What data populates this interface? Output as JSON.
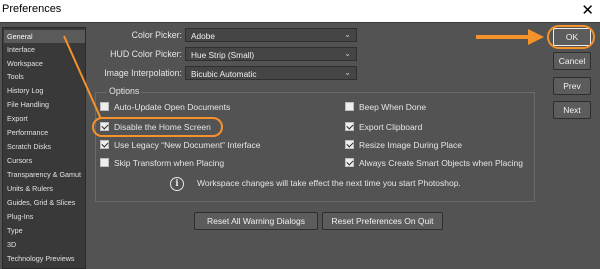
{
  "window": {
    "title": "Preferences",
    "close_glyph": "✕"
  },
  "sidebar": {
    "items": [
      {
        "label": "General",
        "selected": true
      },
      {
        "label": "Interface"
      },
      {
        "label": "Workspace"
      },
      {
        "label": "Tools"
      },
      {
        "label": "History Log"
      },
      {
        "label": "File Handling"
      },
      {
        "label": "Export"
      },
      {
        "label": "Performance"
      },
      {
        "label": "Scratch Disks"
      },
      {
        "label": "Cursors"
      },
      {
        "label": "Transparency & Gamut"
      },
      {
        "label": "Units & Rulers"
      },
      {
        "label": "Guides, Grid & Slices"
      },
      {
        "label": "Plug-Ins"
      },
      {
        "label": "Type"
      },
      {
        "label": "3D"
      },
      {
        "label": "Technology Previews"
      }
    ]
  },
  "general": {
    "color_picker": {
      "label": "Color Picker:",
      "value": "Adobe"
    },
    "hud_color_picker": {
      "label": "HUD Color Picker:",
      "value": "Hue Strip (Small)"
    },
    "image_interpolation": {
      "label": "Image Interpolation:",
      "value": "Bicubic Automatic"
    },
    "options_title": "Options",
    "options": [
      {
        "label": "Auto-Update Open Documents",
        "checked": false
      },
      {
        "label": "Beep When Done",
        "checked": false
      },
      {
        "label": "Disable the Home Screen",
        "checked": true
      },
      {
        "label": "Export Clipboard",
        "checked": true
      },
      {
        "label": "Use Legacy “New Document” Interface",
        "checked": true
      },
      {
        "label": "Resize Image During Place",
        "checked": true
      },
      {
        "label": "Skip Transform when Placing",
        "checked": false
      },
      {
        "label": "Always Create Smart Objects when Placing",
        "checked": true
      }
    ],
    "info_text": "Workspace changes will take effect the next time you start Photoshop.",
    "reset_warnings_label": "Reset All Warning Dialogs",
    "reset_prefs_label": "Reset Preferences On Quit"
  },
  "buttons": {
    "ok": "OK",
    "cancel": "Cancel",
    "prev": "Prev",
    "next": "Next"
  },
  "colors": {
    "annotation": "#f5932a",
    "background": "#535353",
    "sidebar": "#393939"
  },
  "icons": {
    "chevron": "chevron-down-icon",
    "info": "info-icon",
    "close": "close-icon"
  }
}
